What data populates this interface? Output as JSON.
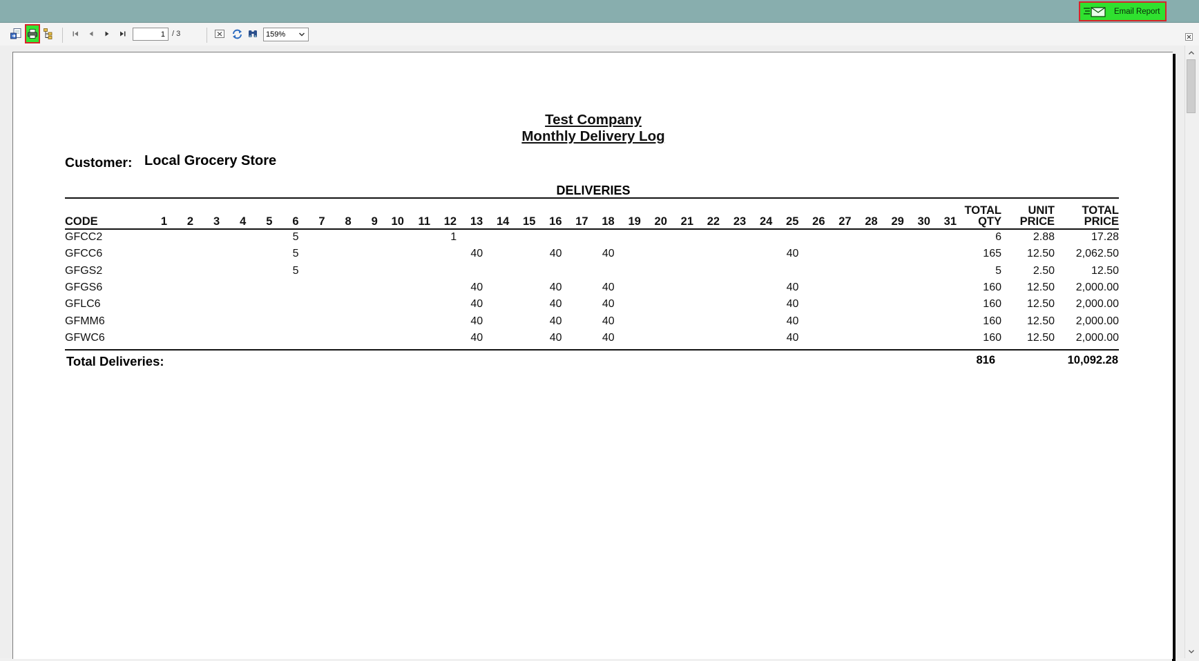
{
  "email_button": {
    "label": "Email Report",
    "icon": "email-report-icon"
  },
  "toolbar": {
    "export_icon": "export-icon",
    "print_icon": "print-icon",
    "group_tree_icon": "group-tree-icon",
    "nav": [
      "first-page-icon",
      "prev-page-icon",
      "next-page-icon",
      "last-page-icon"
    ],
    "page_value": "1",
    "page_total": "/ 3",
    "close_view_icon": "close-view-icon",
    "refresh_icon": "refresh-icon",
    "search_icon": "binoculars-icon",
    "zoom": "159%"
  },
  "report": {
    "company": "Test Company",
    "title": "Monthly Delivery Log",
    "customer_label": "Customer:",
    "customer_name": "Local Grocery Store",
    "section": "DELIVERIES",
    "headers": {
      "code": "CODE",
      "days": [
        "1",
        "2",
        "3",
        "4",
        "5",
        "6",
        "7",
        "8",
        "9",
        "10",
        "11",
        "12",
        "13",
        "14",
        "15",
        "16",
        "17",
        "18",
        "19",
        "20",
        "21",
        "22",
        "23",
        "24",
        "25",
        "26",
        "27",
        "28",
        "29",
        "30",
        "31"
      ],
      "total_qty": [
        "TOTAL",
        "QTY"
      ],
      "unit_price": [
        "UNIT",
        "PRICE"
      ],
      "total_price": [
        "TOTAL",
        "PRICE"
      ]
    },
    "rows": [
      {
        "code": "GFCC2",
        "days": {
          "6": "5",
          "12": "1"
        },
        "total_qty": "6",
        "unit_price": "2.88",
        "total_price": "17.28"
      },
      {
        "code": "GFCC6",
        "days": {
          "6": "5",
          "13": "40",
          "16": "40",
          "18": "40",
          "25": "40"
        },
        "total_qty": "165",
        "unit_price": "12.50",
        "total_price": "2,062.50"
      },
      {
        "code": "GFGS2",
        "days": {
          "6": "5"
        },
        "total_qty": "5",
        "unit_price": "2.50",
        "total_price": "12.50"
      },
      {
        "code": "GFGS6",
        "days": {
          "13": "40",
          "16": "40",
          "18": "40",
          "25": "40"
        },
        "total_qty": "160",
        "unit_price": "12.50",
        "total_price": "2,000.00"
      },
      {
        "code": "GFLC6",
        "days": {
          "13": "40",
          "16": "40",
          "18": "40",
          "25": "40"
        },
        "total_qty": "160",
        "unit_price": "12.50",
        "total_price": "2,000.00"
      },
      {
        "code": "GFMM6",
        "days": {
          "13": "40",
          "16": "40",
          "18": "40",
          "25": "40"
        },
        "total_qty": "160",
        "unit_price": "12.50",
        "total_price": "2,000.00"
      },
      {
        "code": "GFWC6",
        "days": {
          "13": "40",
          "16": "40",
          "18": "40",
          "25": "40"
        },
        "total_qty": "160",
        "unit_price": "12.50",
        "total_price": "2,000.00"
      }
    ],
    "totals": {
      "label": "Total Deliveries:",
      "qty": "816",
      "price": "10,092.28"
    }
  }
}
